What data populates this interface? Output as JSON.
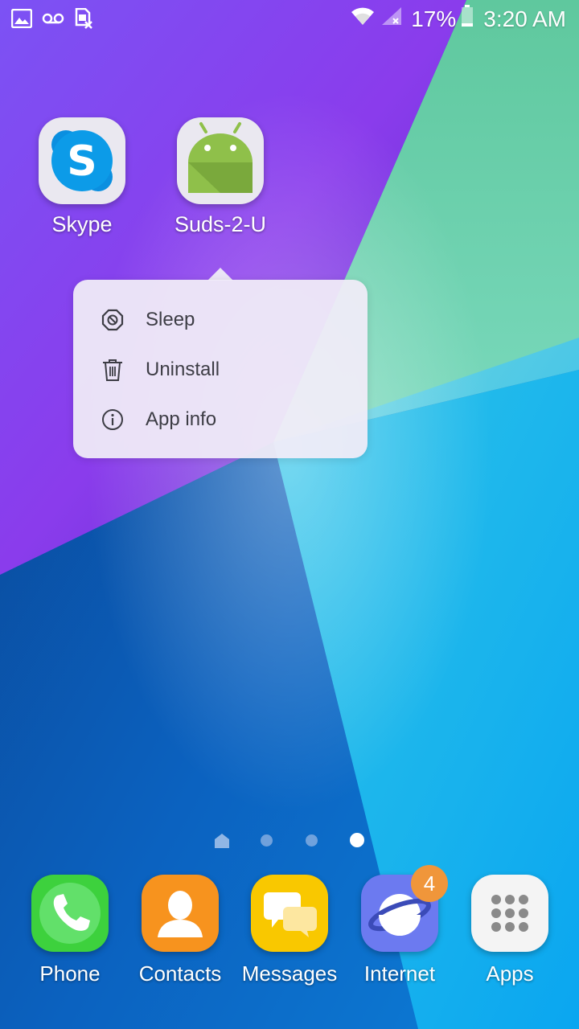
{
  "status_bar": {
    "left_icons": [
      "gallery-icon",
      "voicemail-icon",
      "no-sim-icon"
    ],
    "right_icons": [
      "wifi-icon",
      "no-signal-icon",
      "battery-icon"
    ],
    "battery_percent": "17%",
    "time": "3:20 AM"
  },
  "home_screen": {
    "apps": [
      {
        "label": "Skype",
        "icon": "skype-icon"
      },
      {
        "label": "Suds-2-U",
        "icon": "android-icon"
      }
    ]
  },
  "context_menu": {
    "items": [
      {
        "label": "Sleep",
        "icon": "sleep-icon"
      },
      {
        "label": "Uninstall",
        "icon": "trash-icon"
      },
      {
        "label": "App info",
        "icon": "info-icon"
      }
    ]
  },
  "page_indicator": {
    "pages": 4,
    "active_page": 4,
    "first_is_home": true
  },
  "dock": {
    "apps": [
      {
        "label": "Phone",
        "icon": "phone-icon",
        "color": "#3dd13d"
      },
      {
        "label": "Contacts",
        "icon": "contacts-icon",
        "color": "#f7931e"
      },
      {
        "label": "Messages",
        "icon": "messages-icon",
        "color": "#f9c800"
      },
      {
        "label": "Internet",
        "icon": "internet-icon",
        "color": "#6c7af0",
        "badge": "4"
      },
      {
        "label": "Apps",
        "icon": "apps-grid-icon",
        "color": "#f4f4f4"
      }
    ]
  },
  "colors": {
    "wallpaper_purple": "#7a3df0",
    "wallpaper_green": "#62c9a6",
    "wallpaper_blue": "#0a66c8",
    "badge": "#f0963a"
  }
}
